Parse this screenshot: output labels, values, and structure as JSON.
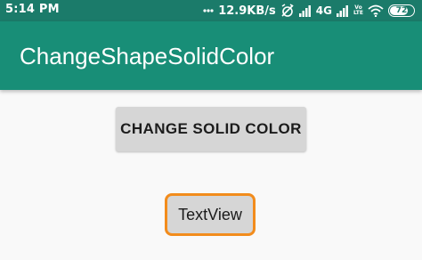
{
  "status_bar": {
    "time": "5:14 PM",
    "net_speed": "12.9KB/s",
    "network_type": "4G",
    "volte_top": "Vo",
    "volte_bottom": "LTE",
    "battery_level": "72",
    "icons": [
      "dots-icon",
      "alarm-off-icon",
      "signal-icon",
      "wifi-icon",
      "battery-icon"
    ]
  },
  "app_bar": {
    "title": "ChangeShapeSolidColor"
  },
  "main": {
    "button_label": "CHANGE SOLID COLOR",
    "textview_text": "TextView"
  },
  "colors": {
    "primary": "#188e77",
    "primary_dark": "#1b7b6a",
    "background": "#f9f9f9",
    "button_bg": "#d6d6d6",
    "textview_border": "#f28c1c"
  }
}
